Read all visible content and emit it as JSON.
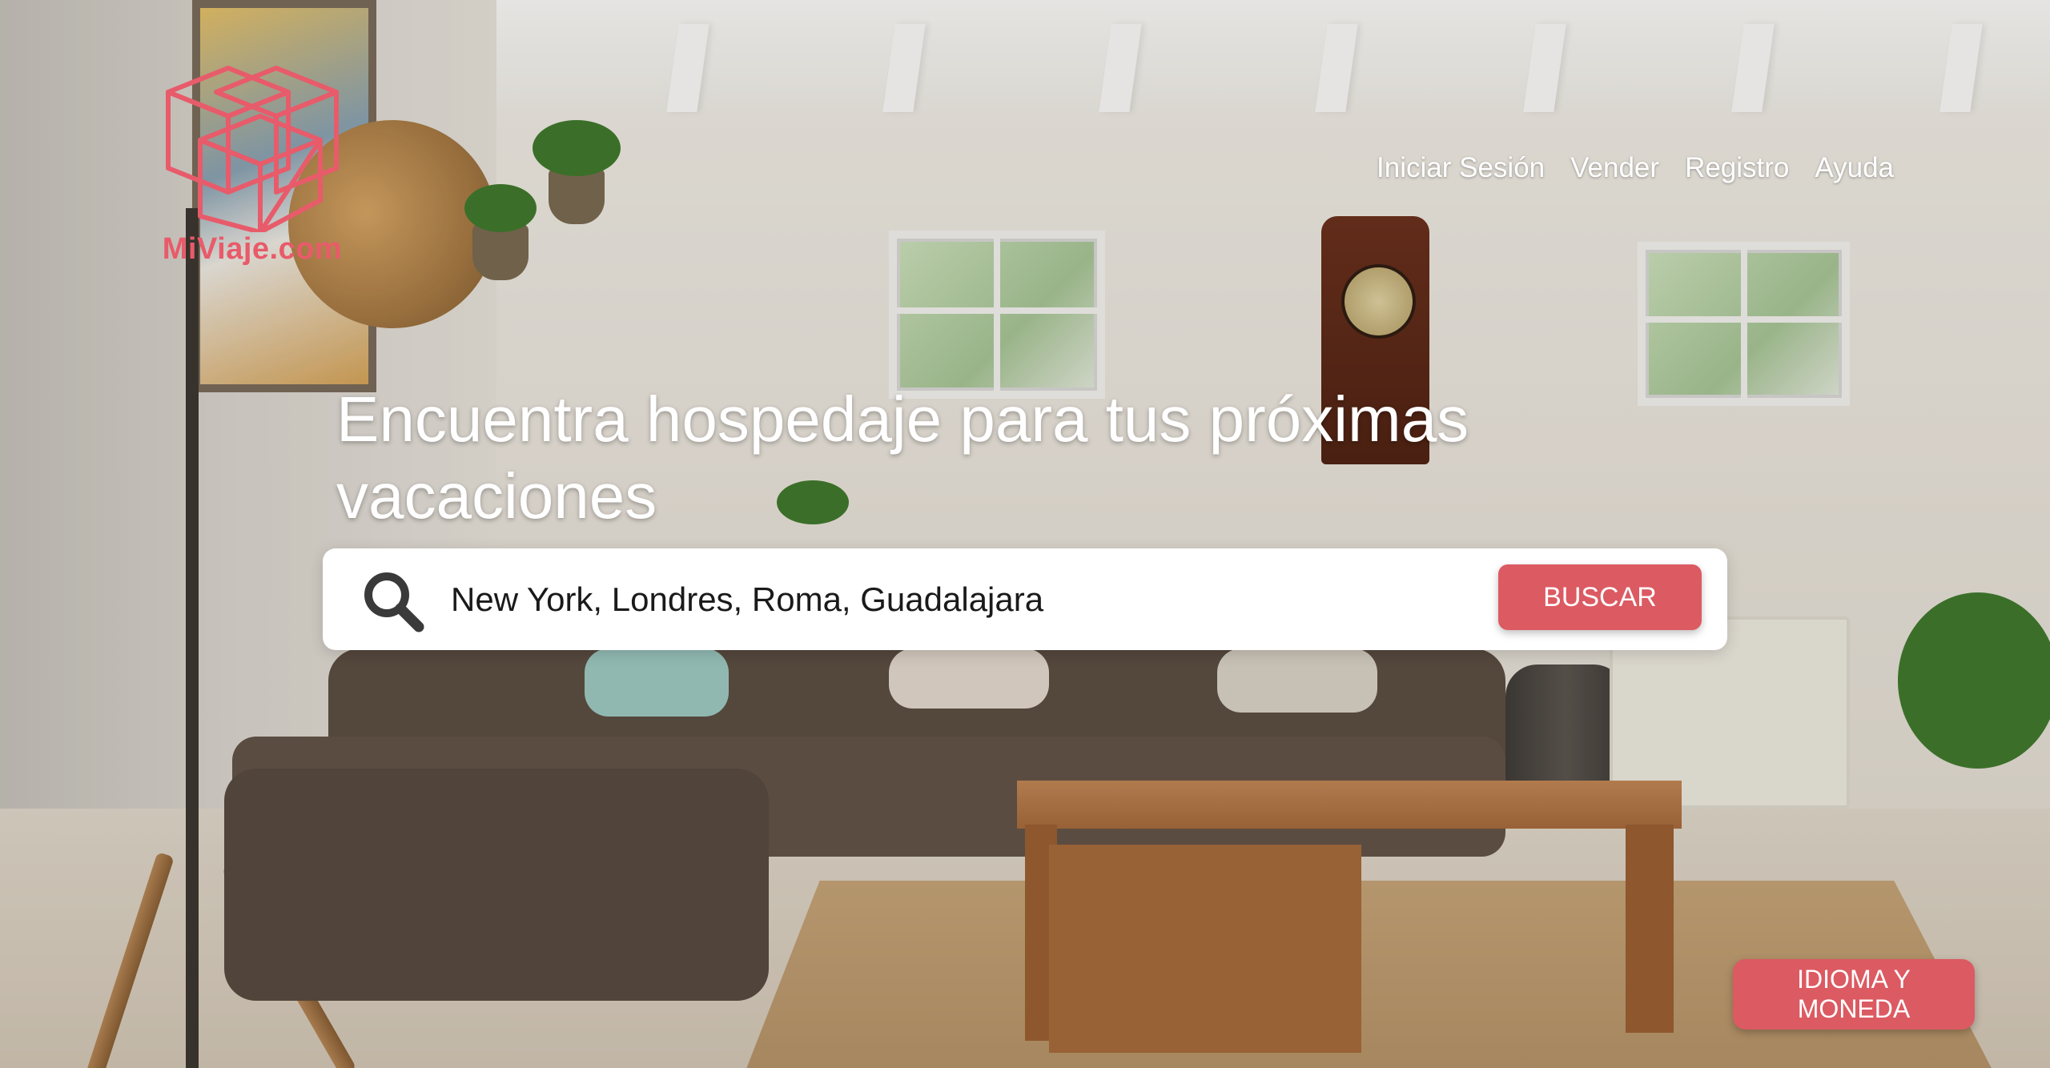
{
  "brand": {
    "name": "MiViaje.com",
    "logo_icon": "cube-logo-icon",
    "accent_color": "#dc5a62"
  },
  "nav": {
    "items": [
      {
        "label": "Iniciar Sesión"
      },
      {
        "label": "Vender"
      },
      {
        "label": "Registro"
      },
      {
        "label": "Ayuda"
      }
    ]
  },
  "hero": {
    "title": "Encuentra hospedaje para tus próximas vacaciones"
  },
  "search": {
    "icon": "search-icon",
    "placeholder": "New York, Londres, Roma, Guadalajara",
    "value": "",
    "button_label": "BUSCAR"
  },
  "footer": {
    "language_button_label": "IDIOMA Y MONEDA"
  }
}
